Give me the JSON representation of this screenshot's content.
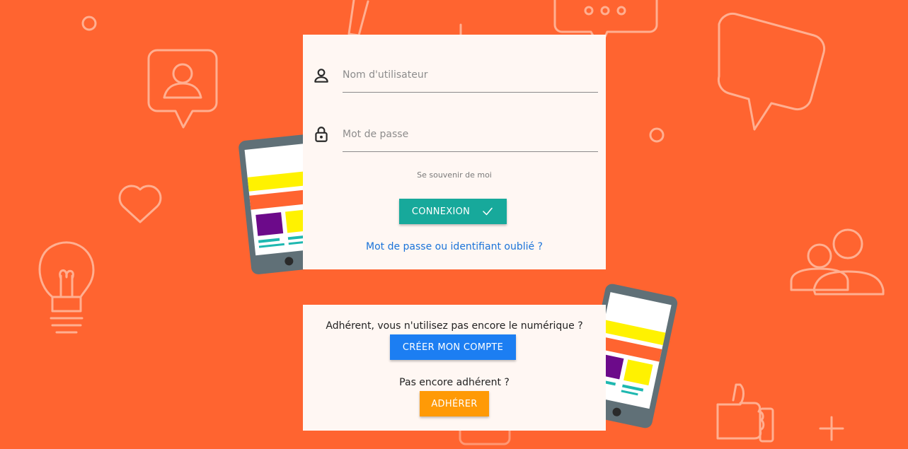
{
  "login": {
    "username_placeholder": "Nom d'utilisateur",
    "password_placeholder": "Mot de passe",
    "remember_me": "Se souvenir de moi",
    "submit_label": "CONNEXION",
    "forgot_link": "Mot de passe ou identifiant oublié ?"
  },
  "signup": {
    "member_prompt": "Adhérent, vous n'utilisez pas encore le numérique ?",
    "create_account_label": "CRÉER MON COMPTE",
    "non_member_prompt": "Pas encore adhérent ?",
    "join_label": "ADHÉRER"
  },
  "icons": {
    "username": "person-icon",
    "password": "lock-icon",
    "submit": "check-icon"
  },
  "colors": {
    "background": "#ff6430",
    "card": "#fff7f3",
    "login_button": "#17a99b",
    "create_account_button": "#1c7ef2",
    "join_button": "#ff9a06",
    "link": "#1a73d9"
  }
}
